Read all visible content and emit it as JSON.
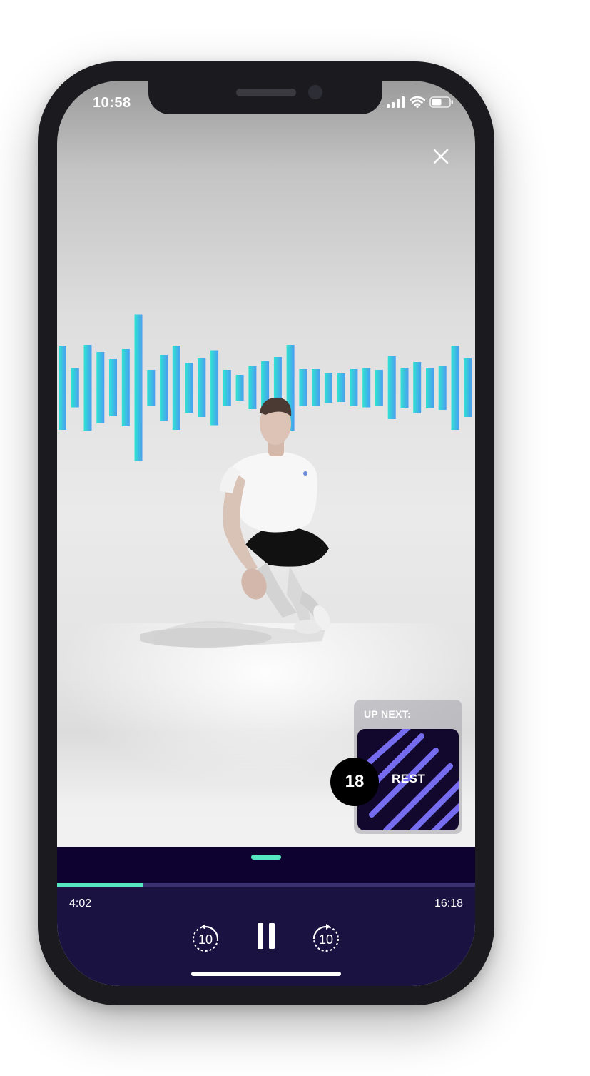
{
  "status_bar": {
    "time": "10:58"
  },
  "up_next": {
    "label": "UP NEXT:",
    "title": "REST",
    "countdown": "18"
  },
  "player": {
    "elapsed": "4:02",
    "total": "16:18",
    "progress": 0.205,
    "rewind_seconds": "10",
    "forward_seconds": "10"
  },
  "colors": {
    "accent": "#57e6c2",
    "player_bg": "#1a1240",
    "player_top": "#0e0230",
    "wave_start": "#2fe3d3",
    "wave_end": "#4a9df0"
  },
  "icons": [
    "signal-icon",
    "wifi-icon",
    "battery-icon",
    "close-icon",
    "rewind-10-icon",
    "pause-icon",
    "forward-10-icon"
  ]
}
